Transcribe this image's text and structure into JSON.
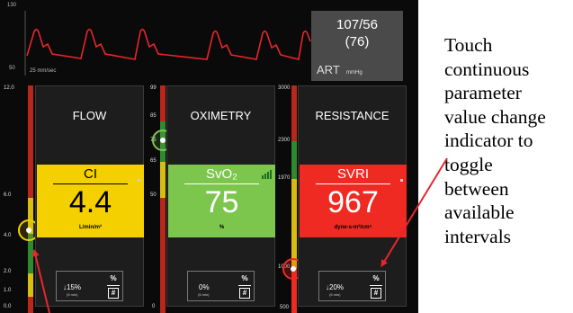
{
  "waveform": {
    "scale_top": "130",
    "scale_bottom": "50",
    "speed": "25 mm/sec"
  },
  "art": {
    "systolic_diastolic": "107/56",
    "mean": "(76)",
    "label": "ART",
    "unit": "mmHg"
  },
  "tiles": [
    {
      "title": "FLOW",
      "parameter": "CI",
      "value": "4.4",
      "unit": "L/min/m²",
      "scale": [
        "12.0",
        "6.0",
        "4.0",
        "2.0",
        "1.0",
        "0.0"
      ],
      "change": {
        "value": "↓15%",
        "interval": "(5 min)",
        "percent_button": "%",
        "number_button": "#"
      }
    },
    {
      "title": "OXIMETRY",
      "parameter": "SvO₂",
      "value": "75",
      "unit": "%",
      "scale": [
        "99",
        "85",
        "75",
        "65",
        "50",
        "0"
      ],
      "change": {
        "value": "0%",
        "interval": "(5 min)",
        "percent_button": "%",
        "number_button": "#"
      }
    },
    {
      "title": "RESISTANCE",
      "parameter": "SVRI",
      "value": "967",
      "unit": "dyne-s-m²/cm⁵",
      "scale": [
        "3000",
        "2300",
        "1970",
        "1000",
        "500"
      ],
      "change": {
        "value": "↓20%",
        "interval": "(5 min)",
        "percent_button": "%",
        "number_button": "#"
      }
    }
  ],
  "callout": {
    "lines": [
      "Touch",
      "continuous",
      "parameter",
      "value change",
      "indicator to",
      "toggle",
      "between",
      "available",
      "intervals"
    ]
  },
  "colors": {
    "yellow": "#f5d000",
    "green": "#7cc64e",
    "red": "#ee2a22"
  }
}
